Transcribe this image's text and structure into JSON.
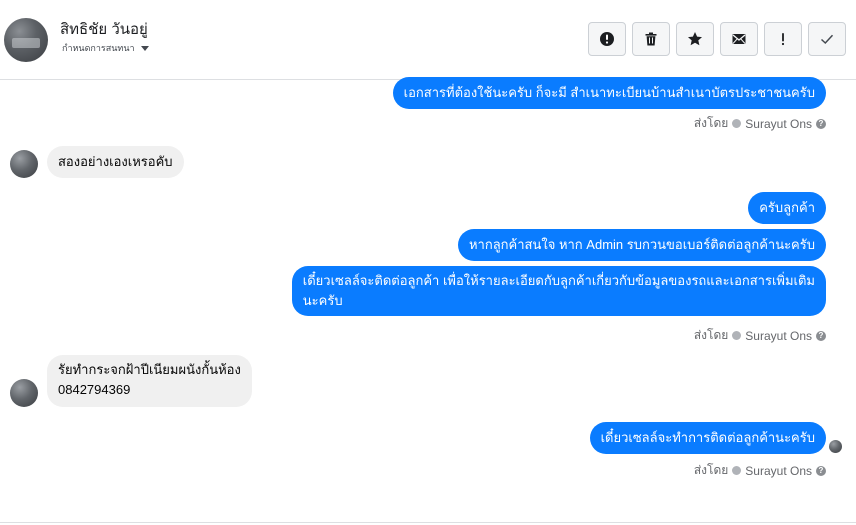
{
  "header": {
    "contact_name": "สิทธิชัย วันอยู่",
    "status_label": "กำหนดการสนทนา",
    "toolbar": [
      {
        "name": "report-button",
        "icon": "exclamation-circle-icon"
      },
      {
        "name": "delete-button",
        "icon": "trash-icon"
      },
      {
        "name": "star-button",
        "icon": "star-icon"
      },
      {
        "name": "mark-unread-button",
        "icon": "envelope-icon"
      },
      {
        "name": "spam-button",
        "icon": "exclamation-icon"
      },
      {
        "name": "done-button",
        "icon": "check-icon"
      }
    ]
  },
  "messages": [
    {
      "direction": "out",
      "text": "เอกสารที่ต้องใช้นะครับ ก็จะมี สำเนาทะเบียนบ้านสำเนาบัตรประชาชนครับ"
    },
    {
      "direction": "in",
      "text": "สองอย่างเองเหรอคับ"
    },
    {
      "direction": "out",
      "text": "ครับลูกค้า"
    },
    {
      "direction": "out",
      "text": "หากลูกค้าสนใจ หาก Admin รบกวนขอเบอร์ติดต่อลูกค้านะครับ"
    },
    {
      "direction": "out",
      "text_line1": "เดี๋ยวเซลล์จะติดต่อลูกค้า เพื่อให้รายละเอียดกับลูกค้าเกี่ยวกับข้อมูลของรถและเอกสารเพิ่มเติม",
      "text_line2": "นะครับ"
    },
    {
      "direction": "in",
      "text_line1": "รัยทำกระจกฝ้าปีเนียมผนังกั้นห้อง",
      "text_line2": "0842794369"
    },
    {
      "direction": "out",
      "text": "เดี๋ยวเซลล์จะทำการติดต่อลูกค้านะครับ"
    }
  ],
  "sent_by": {
    "prefix": "ส่งโดย",
    "name": "Surayut Ons"
  },
  "colors": {
    "outgoing_bubble": "#0a7cff",
    "incoming_bubble": "#f0f0f0"
  }
}
